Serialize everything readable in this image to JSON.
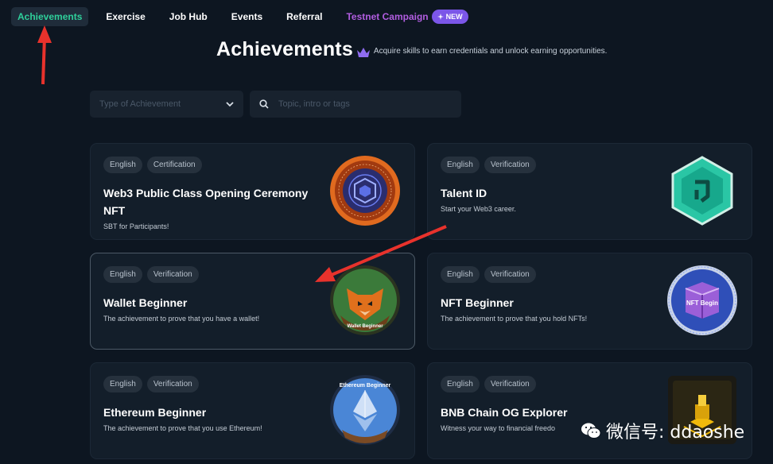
{
  "nav": {
    "items": [
      {
        "label": "Achievements",
        "active": true
      },
      {
        "label": "Exercise"
      },
      {
        "label": "Job Hub"
      },
      {
        "label": "Events"
      },
      {
        "label": "Referral"
      },
      {
        "label": "Testnet Campaign"
      }
    ],
    "new_badge": "NEW"
  },
  "hero": {
    "title": "Achievements",
    "subtitle": "Acquire skills to earn credentials and unlock earning opportunities."
  },
  "filters": {
    "type_placeholder": "Type of Achievement",
    "search_placeholder": "Topic, intro or tags"
  },
  "cards": [
    {
      "tags": [
        "English",
        "Certification"
      ],
      "title": "Web3 Public Class Opening Ceremony NFT",
      "desc": "SBT for Participants!",
      "badge_icon": "web3-class-nft-badge"
    },
    {
      "tags": [
        "English",
        "Verification"
      ],
      "title": "Talent ID",
      "desc": "Start your Web3 career.",
      "badge_icon": "talent-id-badge"
    },
    {
      "tags": [
        "English",
        "Verification"
      ],
      "title": "Wallet Beginner",
      "desc": "The achievement to prove that you have a wallet!",
      "badge_icon": "wallet-beginner-fox-badge",
      "badge_text": "Wallet Beginner"
    },
    {
      "tags": [
        "English",
        "Verification"
      ],
      "title": "NFT Beginner",
      "desc": "The achievement to prove that you hold NFTs!",
      "badge_icon": "nft-beginner-badge",
      "badge_text": "NFT Begin"
    },
    {
      "tags": [
        "English",
        "Verification"
      ],
      "title": "Ethereum Beginner",
      "desc": "The achievement to prove that you use Ethereum!",
      "badge_icon": "ethereum-beginner-badge",
      "badge_text": "Ethereum Beginner"
    },
    {
      "tags": [
        "English",
        "Verification"
      ],
      "title": "BNB Chain OG Explorer",
      "desc": "Witness your way to financial freedo",
      "badge_icon": "bnb-chain-explorer-badge"
    }
  ],
  "watermark": {
    "text": "微信号: ddaoshe"
  },
  "colors": {
    "background": "#0d1621",
    "accent": "#2ecf9a",
    "campaign": "#b15de0",
    "new_badge": "#7b56e8",
    "annotation_arrow": "#e8322c"
  }
}
